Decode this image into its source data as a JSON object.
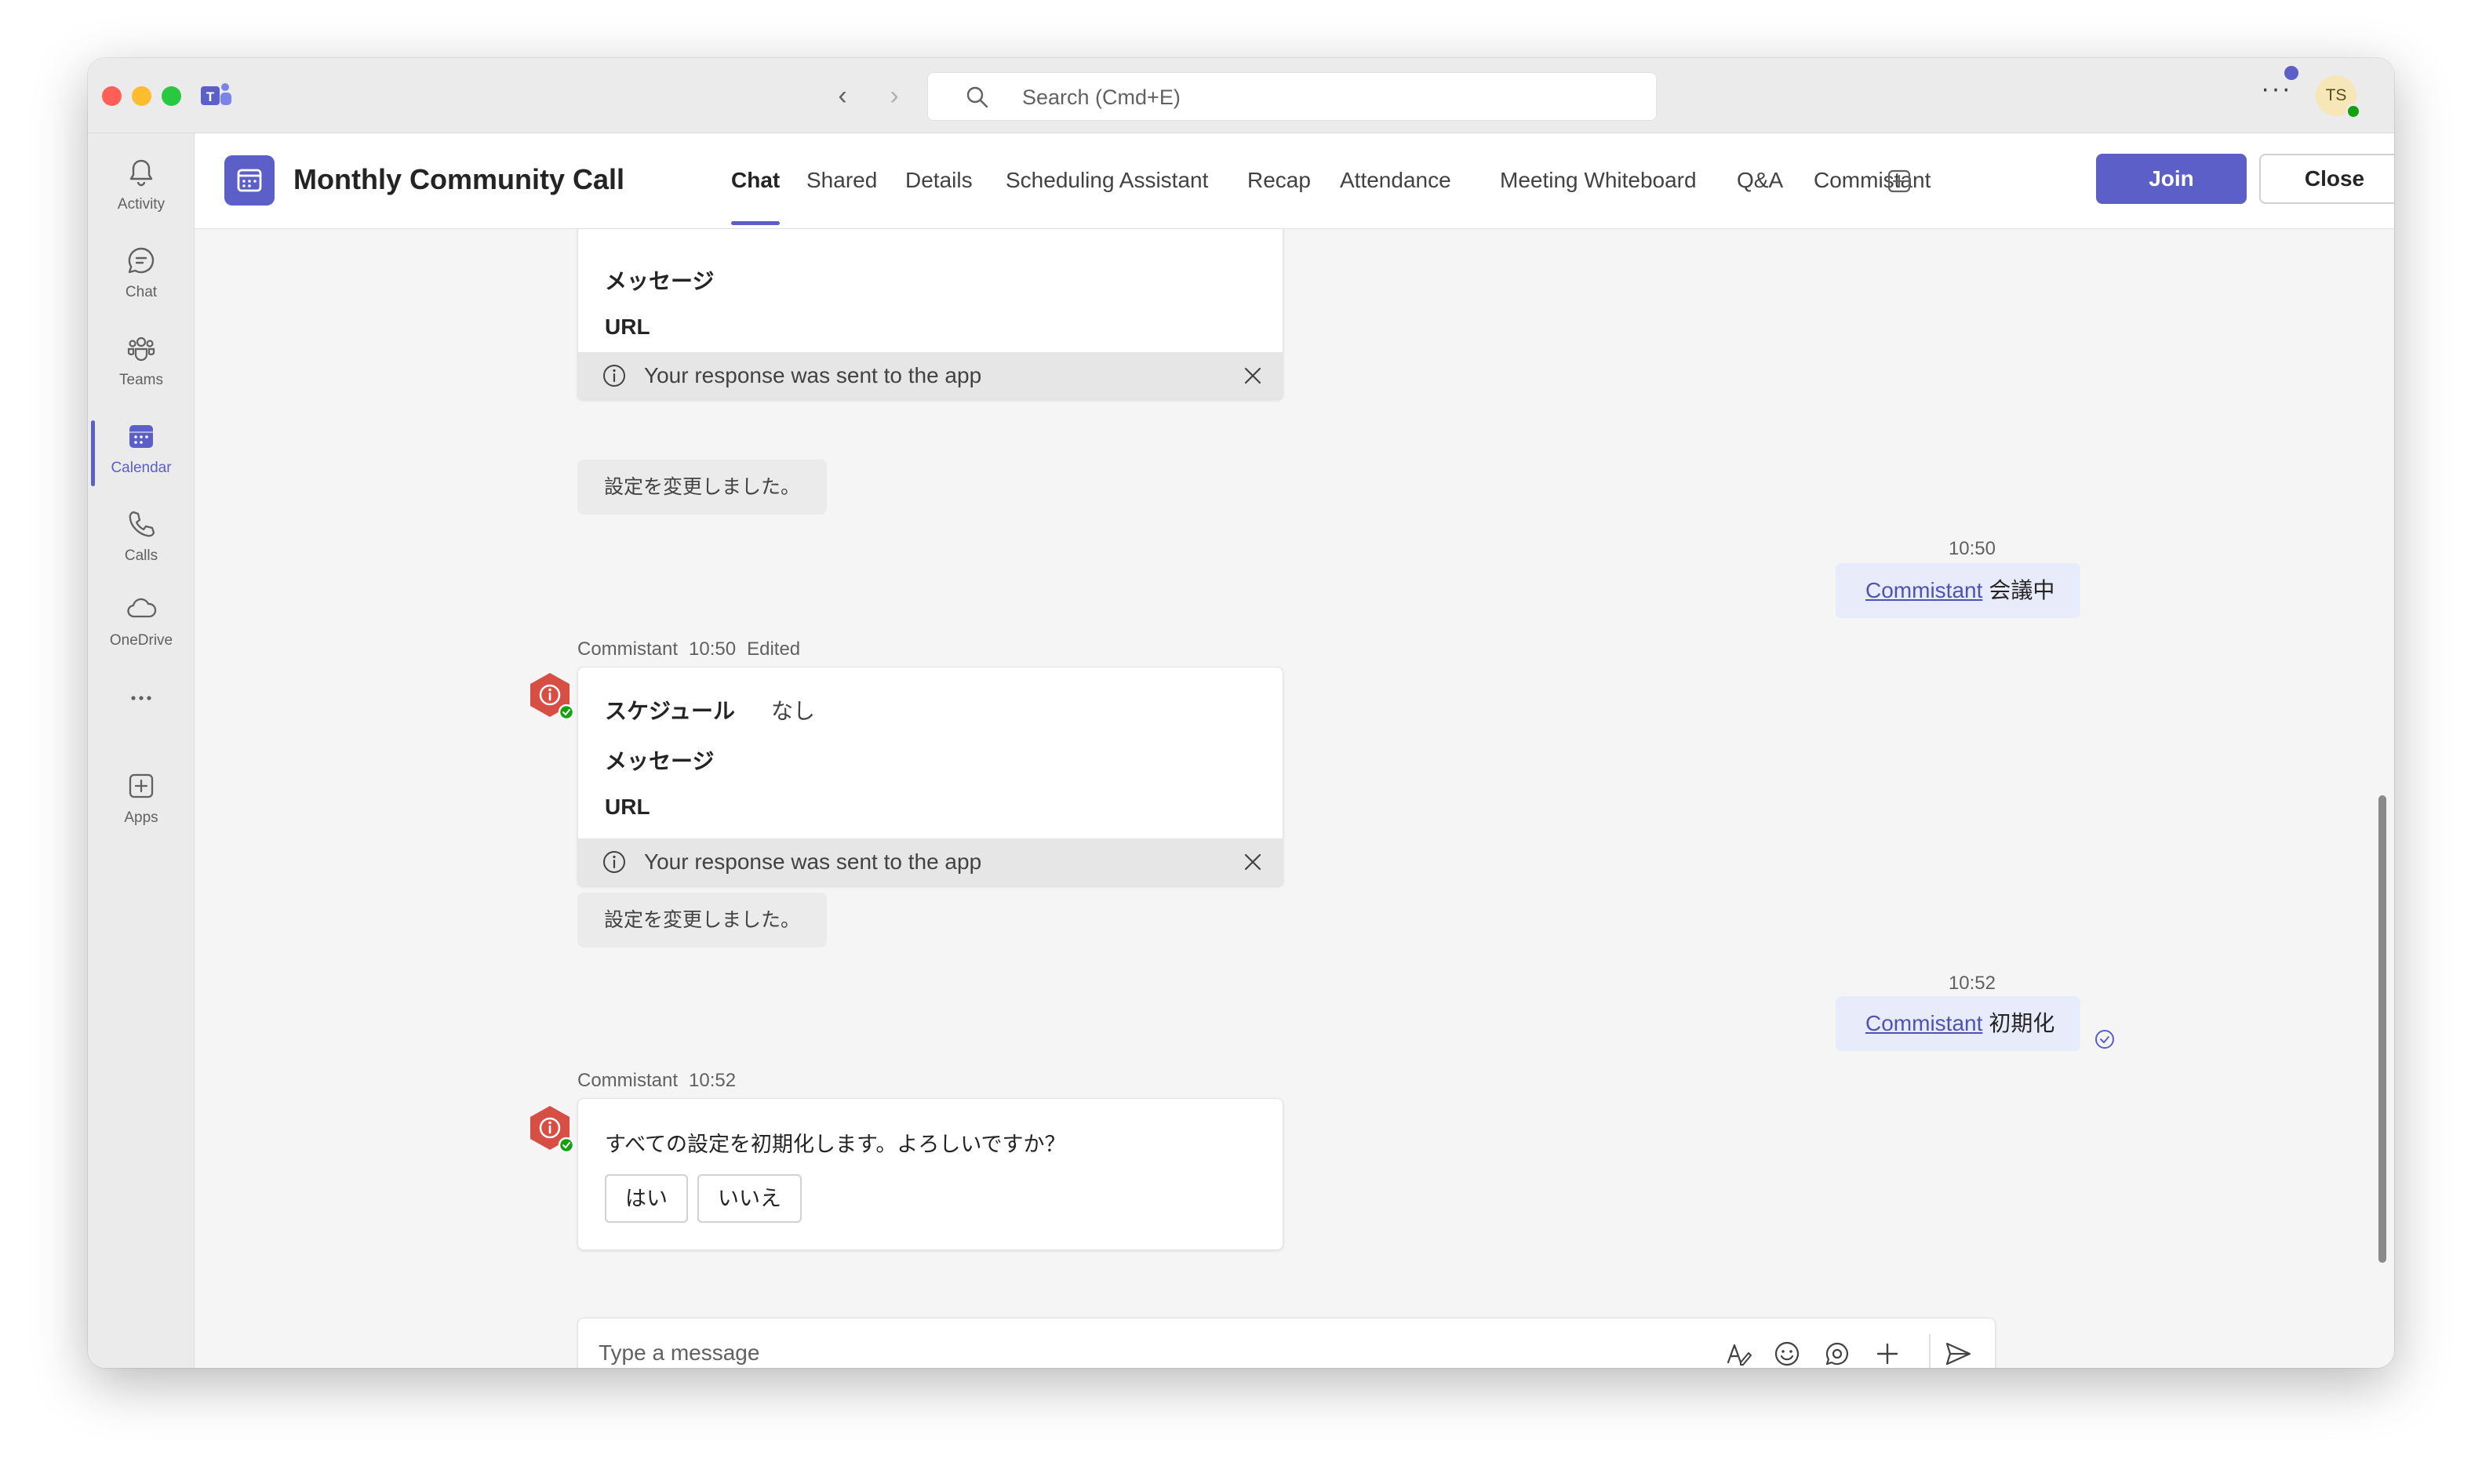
{
  "search": {
    "placeholder": "Search (Cmd+E)"
  },
  "user": {
    "initials": "TS"
  },
  "rail": [
    {
      "label": "Activity",
      "icon": "bell-icon"
    },
    {
      "label": "Chat",
      "icon": "chat-icon"
    },
    {
      "label": "Teams",
      "icon": "teams-icon"
    },
    {
      "label": "Calendar",
      "icon": "calendar-icon",
      "active": true
    },
    {
      "label": "Calls",
      "icon": "phone-icon"
    },
    {
      "label": "OneDrive",
      "icon": "cloud-icon"
    },
    {
      "label": "",
      "icon": "more-icon"
    },
    {
      "label": "Apps",
      "icon": "add-app-icon"
    }
  ],
  "header": {
    "title": "Monthly Community Call",
    "tabs": [
      "Chat",
      "Shared",
      "Details",
      "Scheduling Assistant",
      "Recap",
      "Attendance",
      "Meeting Whiteboard",
      "Q&A",
      "Commistant"
    ],
    "join": "Join",
    "close": "Close"
  },
  "messages": {
    "card1": {
      "rows": [
        "メッセージ",
        "URL"
      ],
      "response": "Your response was sent to the app",
      "note": "設定を変更しました。"
    },
    "mine1": {
      "time": "10:50",
      "mention": "Commistant",
      "text": "会議中"
    },
    "bot2": {
      "sender": "Commistant",
      "time": "10:50",
      "edited": "Edited",
      "rows": [
        {
          "key": "スケジュール",
          "value": "なし"
        },
        {
          "key": "メッセージ",
          "value": ""
        },
        {
          "key": "URL",
          "value": ""
        }
      ],
      "response": "Your response was sent to the app",
      "note": "設定を変更しました。"
    },
    "mine2": {
      "time": "10:52",
      "mention": "Commistant",
      "text": "初期化"
    },
    "bot3": {
      "sender": "Commistant",
      "time": "10:52",
      "question": "すべての設定を初期化します。よろしいですか？",
      "yes": "はい",
      "no": "いいえ"
    }
  },
  "composer": {
    "placeholder": "Type a message"
  },
  "colors": {
    "accent": "#5b5fc7",
    "bot_avatar": "#d74f44",
    "my_bubble": "#e8ebfa"
  }
}
